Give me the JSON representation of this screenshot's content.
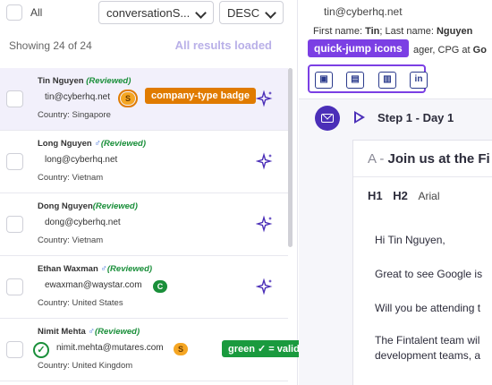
{
  "toolbar": {
    "all_label": "All",
    "sort_field": "conversationS...",
    "sort_dir": "DESC",
    "showing": "Showing 24 of 24",
    "loaded": "All results loaded"
  },
  "contacts": [
    {
      "name": "Tin Nguyen",
      "gender": "",
      "reviewed": "(Reviewed)",
      "email": "tin@cyberhq.net",
      "badge": "S",
      "country": "Country: Singapore"
    },
    {
      "name": "Long Nguyen",
      "gender": "♂",
      "reviewed": "(Reviewed)",
      "email": "long@cyberhq.net",
      "badge": "",
      "country": "Country: Vietnam"
    },
    {
      "name": "Dong Nguyen",
      "gender": "",
      "reviewed": "(Reviewed)",
      "email": "dong@cyberhq.net",
      "badge": "",
      "country": "Country: Vietnam"
    },
    {
      "name": "Ethan Waxman",
      "gender": "♂",
      "reviewed": "(Reviewed)",
      "email": "ewaxman@waystar.com",
      "badge": "C",
      "country": "Country: United States"
    },
    {
      "name": "Nimit Mehta",
      "gender": "♂",
      "reviewed": "(Reviewed)",
      "email": "nimit.mehta@mutares.com",
      "badge": "S",
      "country": "Country: United Kingdom"
    }
  ],
  "annotations": {
    "company_badge": "company-type badge",
    "valid_email": "green ✓ = valid email",
    "quick_jump": "quick-jump icons"
  },
  "detail": {
    "email": "tin@cyberhq.net",
    "first_name_label": "First name: ",
    "first_name": "Tin",
    "last_name_label": "; Last name: ",
    "last_name": "Nguyen",
    "title_fragment": "ager, CPG at ",
    "company_fragment": "Go",
    "step_label": "Step 1 - Day 1",
    "subject_variant": "A - ",
    "subject_text": "Join us at the Fi",
    "editor_h1": "H1",
    "editor_h2": "H2",
    "editor_font": "Arial",
    "body_lines": [
      "Hi Tin Nguyen,",
      "Great to see Google is",
      "Will you be attending t",
      "The Fintalent team wil",
      "development teams, a"
    ]
  },
  "colors": {
    "accent": "#4b2fb8",
    "annotation_purple": "#7b3fe4",
    "annotation_orange": "#e07b00",
    "valid_green": "#1a9a3e",
    "badge_s": "#f5a623",
    "badge_c": "#1a8f3a",
    "loaded_text": "#b9b0e8",
    "selected_row": "#f2f0fb"
  },
  "icons": [
    "checkbox-icon",
    "chevron-down-icon",
    "sparkle-icon",
    "valid-email-check-icon",
    "mail-icon",
    "play-icon",
    "contact-card-icon",
    "calendar-contact-icon",
    "building-icon",
    "linkedin-icon"
  ]
}
